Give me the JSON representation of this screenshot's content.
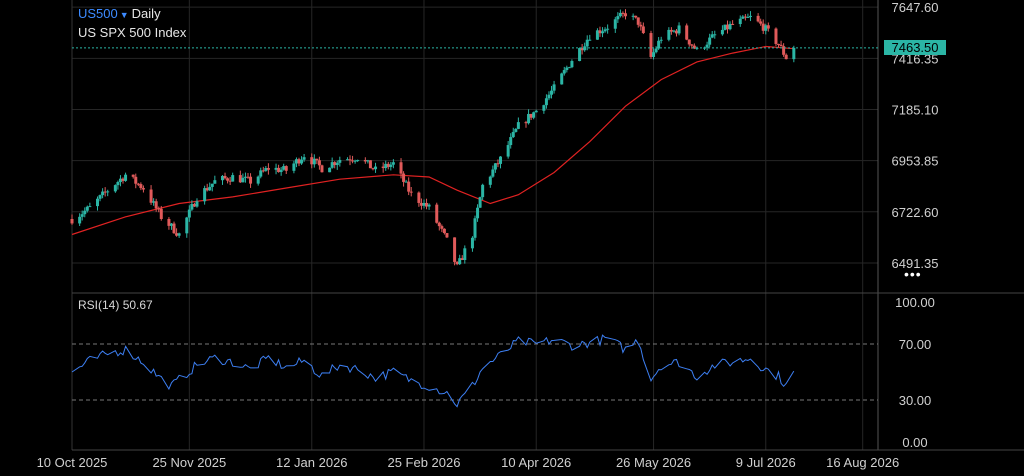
{
  "header": {
    "symbol": "US500",
    "timeframe": "Daily",
    "instrument_name": "US SPX 500 Index",
    "current_price": "7463.50"
  },
  "rsi_panel": {
    "label": "RSI(14)",
    "value": "50.67"
  },
  "colors": {
    "background": "#000000",
    "up_candle": "#2bb5a5",
    "down_candle": "#e05a5a",
    "moving_average": "#e02222",
    "rsi_line": "#3d7ff2",
    "price_badge": "#2bb5a5",
    "grid": "#262626",
    "symbol": "#3d8bff"
  },
  "icons": {
    "dropdown": "triangle-down-icon",
    "more": "more-dots-icon"
  },
  "chart_data": [
    {
      "type": "candlestick",
      "ylim": [
        6360,
        7680
      ],
      "y_ticks": [
        6491.35,
        6722.6,
        6953.85,
        7185.1,
        7416.35,
        7647.6
      ],
      "y_tick_labels": [
        "6491.35",
        "6722.60",
        "6953.85",
        "7185.10",
        "7416.35",
        "7647.60"
      ],
      "x_tick_labels": [
        "10 Oct 2025",
        "25 Nov 2025",
        "12 Jan 2026",
        "25 Feb 2026",
        "10 Apr 2026",
        "26 May 2026",
        "9 Jul 2026",
        "16 Aug 2026"
      ],
      "x_ticks": [
        "2025-10-10",
        "2025-11-25",
        "2026-01-12",
        "2026-02-25",
        "2026-04-10",
        "2026-05-26",
        "2026-07-09",
        "2026-08-16"
      ],
      "x_range": [
        "2025-10-10",
        "2026-08-22"
      ],
      "last_price": 7463.5,
      "anchors": [
        [
          "2025-10-10",
          6690
        ],
        [
          "2025-10-17",
          6740
        ],
        [
          "2025-10-24",
          6820
        ],
        [
          "2025-10-31",
          6890
        ],
        [
          "2025-11-07",
          6830
        ],
        [
          "2025-11-14",
          6700
        ],
        [
          "2025-11-21",
          6620
        ],
        [
          "2025-11-28",
          6790
        ],
        [
          "2025-12-05",
          6860
        ],
        [
          "2025-12-12",
          6880
        ],
        [
          "2025-12-19",
          6860
        ],
        [
          "2025-12-26",
          6920
        ],
        [
          "2026-01-02",
          6910
        ],
        [
          "2026-01-09",
          6980
        ],
        [
          "2026-01-16",
          6920
        ],
        [
          "2026-01-23",
          6960
        ],
        [
          "2026-01-30",
          6970
        ],
        [
          "2026-02-06",
          6910
        ],
        [
          "2026-02-13",
          6940
        ],
        [
          "2026-02-20",
          6800
        ],
        [
          "2026-02-27",
          6740
        ],
        [
          "2026-03-06",
          6590
        ],
        [
          "2026-03-10",
          6470
        ],
        [
          "2026-03-16",
          6620
        ],
        [
          "2026-03-20",
          6840
        ],
        [
          "2026-03-27",
          6960
        ],
        [
          "2026-04-03",
          7110
        ],
        [
          "2026-04-10",
          7180
        ],
        [
          "2026-04-17",
          7280
        ],
        [
          "2026-04-24",
          7410
        ],
        [
          "2026-05-01",
          7520
        ],
        [
          "2026-05-08",
          7560
        ],
        [
          "2026-05-15",
          7620
        ],
        [
          "2026-05-20",
          7580
        ],
        [
          "2026-05-25",
          7420
        ],
        [
          "2026-05-29",
          7510
        ],
        [
          "2026-06-05",
          7550
        ],
        [
          "2026-06-12",
          7450
        ],
        [
          "2026-06-19",
          7520
        ],
        [
          "2026-06-26",
          7570
        ],
        [
          "2026-07-03",
          7600
        ],
        [
          "2026-07-08",
          7560
        ],
        [
          "2026-07-14",
          7480
        ],
        [
          "2026-07-18",
          7400
        ],
        [
          "2026-07-20",
          7463.5
        ]
      ],
      "moving_average": [
        [
          "2025-10-10",
          6620
        ],
        [
          "2025-10-31",
          6700
        ],
        [
          "2025-11-21",
          6760
        ],
        [
          "2025-12-12",
          6790
        ],
        [
          "2026-01-02",
          6830
        ],
        [
          "2026-01-23",
          6870
        ],
        [
          "2026-02-13",
          6890
        ],
        [
          "2026-02-27",
          6880
        ],
        [
          "2026-03-10",
          6820
        ],
        [
          "2026-03-23",
          6760
        ],
        [
          "2026-04-03",
          6800
        ],
        [
          "2026-04-17",
          6900
        ],
        [
          "2026-05-01",
          7040
        ],
        [
          "2026-05-15",
          7200
        ],
        [
          "2026-05-29",
          7320
        ],
        [
          "2026-06-12",
          7400
        ],
        [
          "2026-06-26",
          7440
        ],
        [
          "2026-07-09",
          7470
        ],
        [
          "2026-07-20",
          7460
        ]
      ]
    },
    {
      "type": "line",
      "ylim": [
        0,
        100
      ],
      "y_ticks": [
        0,
        30,
        70,
        100
      ],
      "y_tick_labels": [
        "0.00",
        "30.00",
        "70.00",
        "100.00"
      ],
      "reference_lines": [
        30,
        70
      ],
      "series": [
        {
          "name": "RSI(14)",
          "points": [
            [
              "2025-10-10",
              50
            ],
            [
              "2025-10-17",
              58
            ],
            [
              "2025-10-24",
              63
            ],
            [
              "2025-10-31",
              66
            ],
            [
              "2025-11-07",
              57
            ],
            [
              "2025-11-14",
              45
            ],
            [
              "2025-11-18",
              40
            ],
            [
              "2025-11-28",
              55
            ],
            [
              "2025-12-05",
              60
            ],
            [
              "2025-12-12",
              57
            ],
            [
              "2025-12-19",
              52
            ],
            [
              "2025-12-26",
              60
            ],
            [
              "2026-01-02",
              53
            ],
            [
              "2026-01-09",
              58
            ],
            [
              "2026-01-16",
              47
            ],
            [
              "2026-01-23",
              55
            ],
            [
              "2026-01-30",
              52
            ],
            [
              "2026-02-06",
              46
            ],
            [
              "2026-02-13",
              50
            ],
            [
              "2026-02-20",
              44
            ],
            [
              "2026-02-27",
              40
            ],
            [
              "2026-03-06",
              35
            ],
            [
              "2026-03-10",
              27
            ],
            [
              "2026-03-16",
              40
            ],
            [
              "2026-03-20",
              53
            ],
            [
              "2026-03-27",
              62
            ],
            [
              "2026-04-03",
              72
            ],
            [
              "2026-04-10",
              70
            ],
            [
              "2026-04-17",
              73
            ],
            [
              "2026-04-24",
              69
            ],
            [
              "2026-05-01",
              71
            ],
            [
              "2026-05-08",
              74
            ],
            [
              "2026-05-15",
              66
            ],
            [
              "2026-05-20",
              73
            ],
            [
              "2026-05-25",
              45
            ],
            [
              "2026-05-29",
              55
            ],
            [
              "2026-06-05",
              57
            ],
            [
              "2026-06-12",
              47
            ],
            [
              "2026-06-19",
              55
            ],
            [
              "2026-06-26",
              57
            ],
            [
              "2026-07-03",
              60
            ],
            [
              "2026-07-08",
              53
            ],
            [
              "2026-07-14",
              47
            ],
            [
              "2026-07-18",
              38
            ],
            [
              "2026-07-20",
              50.67
            ]
          ]
        }
      ]
    }
  ]
}
